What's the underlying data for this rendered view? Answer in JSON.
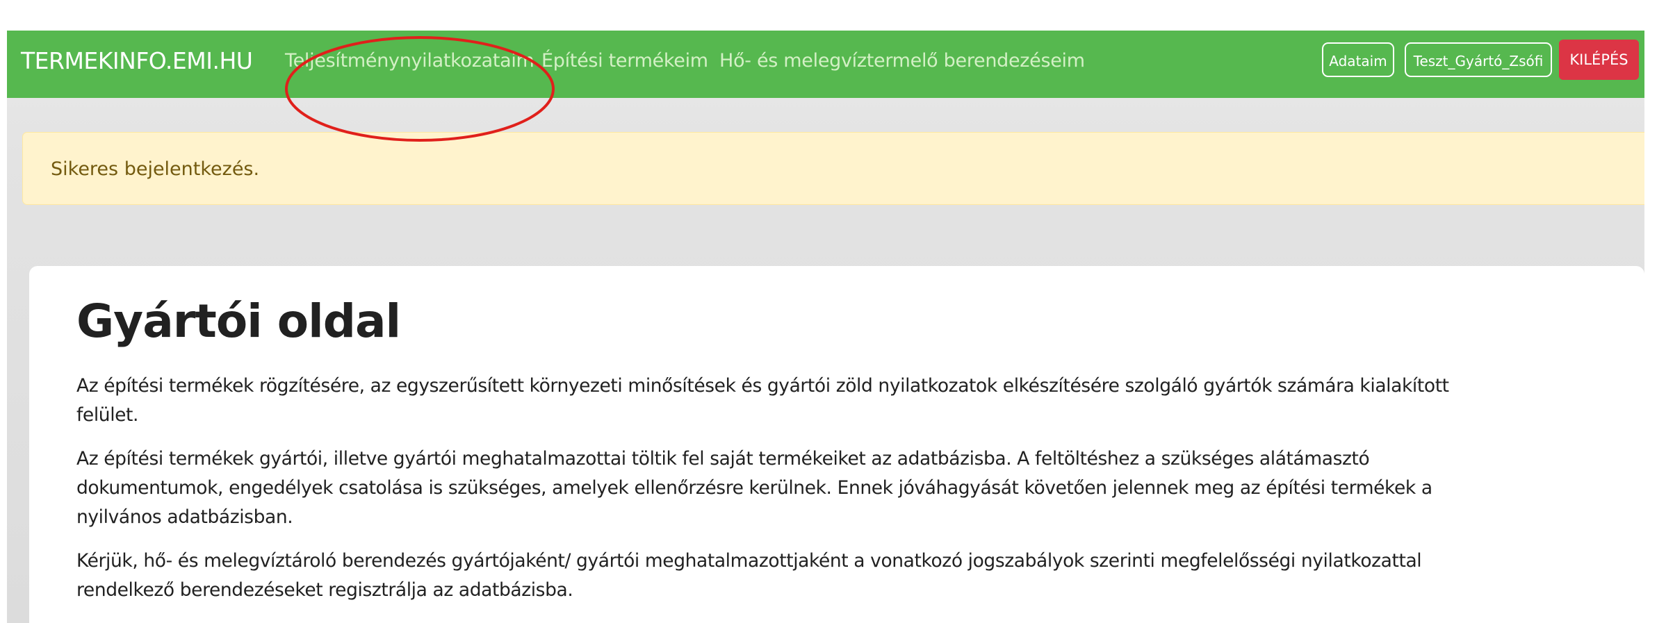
{
  "navbar": {
    "brand": "TERMEKINFO.EMI.HU",
    "links": [
      "Teljesítménynyilatkozataim",
      "Építési termékeim",
      "Hő- és melegvíztermelő berendezéseim"
    ],
    "account_label": "Adataim",
    "user_label": "Teszt_Gyártó_Zsófi",
    "logout_label": "KILÉPÉS"
  },
  "alert": {
    "message": "Sikeres bejelentkezés."
  },
  "main": {
    "title": "Gyártói oldal",
    "paragraphs": [
      "Az építési termékek rögzítésére, az egyszerűsített környezeti minősítések és gyártói zöld nyilatkozatok elkészítésére szolgáló gyártók számára kialakított\nfelület.",
      "Az építési termékek gyártói, illetve gyártói meghatalmazottai töltik fel saját termékeiket az adatbázisba. A feltöltéshez a szükséges alátámasztó\ndokumentumok, engedélyek csatolása is szükséges, amelyek ellenőrzésre kerülnek. Ennek jóváhagyását követően jelennek meg az építési termékek a\nnyilvános adatbázisban.",
      "Kérjük, hő- és melegvíztároló berendezés gyártójaként/ gyártói meghatalmazottjaként a vonatkozó jogszabályok szerinti megfelelősségi nyilatkozattal\nrendelkező berendezéseket regisztrálja az adatbázisba."
    ]
  },
  "colors": {
    "navbar_bg": "#56b84f",
    "nav_link": "#d3f0c5",
    "logout_bg": "#dc3545",
    "alert_bg": "#fff3cd",
    "alert_text": "#735a0f",
    "highlight_ellipse": "#e0201b"
  }
}
